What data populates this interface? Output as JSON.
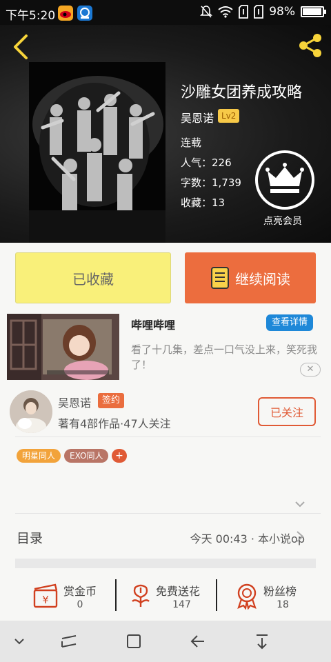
{
  "status_bar": {
    "time": "下午5:20",
    "battery": "98%",
    "battery_level": 0.98
  },
  "book": {
    "title": "沙雕女团养成攻略",
    "author": "吴恩诺",
    "level": "Lv2",
    "status": "连载",
    "popularity": "人气：226",
    "word_count": "字数：1,739",
    "collections": "收藏：13",
    "vip_label": "点亮会员"
  },
  "actions": {
    "favorited": "已收藏",
    "continue_read": "继续阅读"
  },
  "ad": {
    "name": "哔哩哔哩",
    "details_button": "查看详情",
    "text": "看了十几集，差点一口气没上来，笑死我了！",
    "close": "✕"
  },
  "author_card": {
    "name": "吴恩诺",
    "badge": "签约",
    "summary": "著有4部作品·47人关注",
    "follow_button": "已关注"
  },
  "tags": [
    {
      "label": "明星同人",
      "color": "#f2a33a"
    },
    {
      "label": "EXO同人",
      "color": "#b97566"
    }
  ],
  "tag_add": "+",
  "toc": {
    "label": "目录",
    "latest": "今天 00:43 · 本小说op"
  },
  "bottom_stats": [
    {
      "label": "赏金币",
      "value": "0",
      "icon": "money-icon"
    },
    {
      "label": "免费送花",
      "value": "147",
      "icon": "flower-icon"
    },
    {
      "label": "粉丝榜",
      "value": "18",
      "icon": "medal-icon"
    }
  ],
  "colors": {
    "accent": "#ec6d3e",
    "favorite_bg": "#f9f07a",
    "share_icon": "#f7d43a",
    "ad_button": "#1e88d8"
  }
}
